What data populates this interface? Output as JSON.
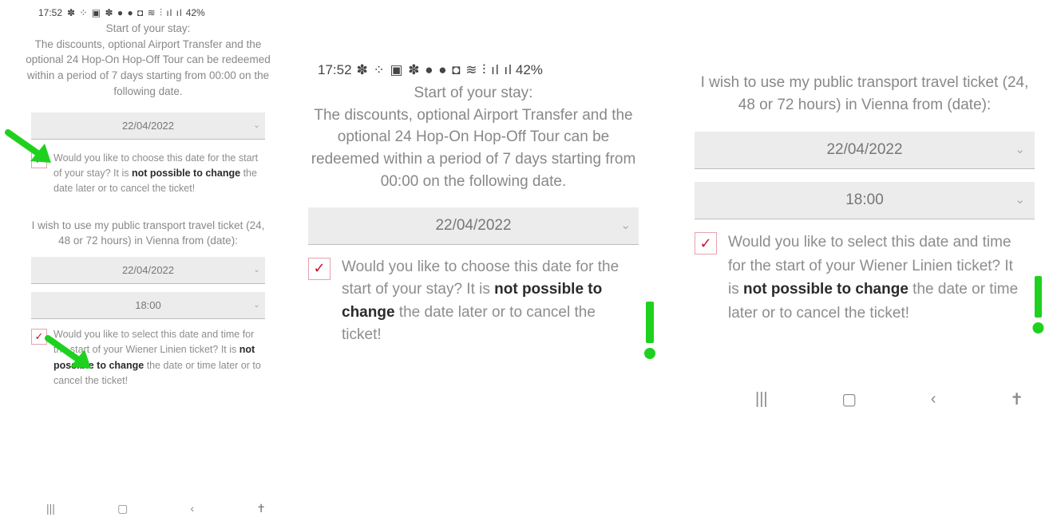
{
  "status": {
    "time": "17:52",
    "icons": "✽ ⁘ ▣ ✽ ● ● ◘ ≋ ⫶ ıl ıl",
    "battery": "42%"
  },
  "stay": {
    "heading": "Start of your stay:",
    "description": "The discounts, optional Airport Transfer and the optional 24 Hop-On Hop-Off Tour can be redeemed within a period of 7 days starting from 00:00 on the following date.",
    "date_value": "22/04/2022",
    "consent_pre": "Would you like to choose this date for the start of your stay? It is ",
    "consent_bold": "not possible to change",
    "consent_post": " the date later or to cancel the ticket!"
  },
  "transport": {
    "description": "I wish to use my public transport travel ticket (24, 48 or 72 hours) in Vienna from (date):",
    "date_value": "22/04/2022",
    "time_value": "18:00",
    "consent_pre": "Would you like to select this date and time for the start of your Wiener Linien ticket? It is ",
    "consent_bold": "not possible to change",
    "consent_post": " the date or time later or to cancel the ticket!"
  },
  "icons": {
    "select_chevron": "chevron-down-icon",
    "checkbox_check": "check-icon",
    "nav_recent": "recent-apps-icon",
    "nav_home": "home-icon",
    "nav_back": "back-icon",
    "nav_accessibility": "accessibility-icon"
  },
  "glyphs": {
    "chevron": "⌄",
    "check": "✓",
    "recent": "|||",
    "home": "▢",
    "back": "‹",
    "accessibility": "✝"
  },
  "colors": {
    "annotation": "#1fd11f",
    "checkbox_border": "#e7a1ad",
    "check_mark": "#c8102e",
    "select_bg": "#ececec"
  }
}
